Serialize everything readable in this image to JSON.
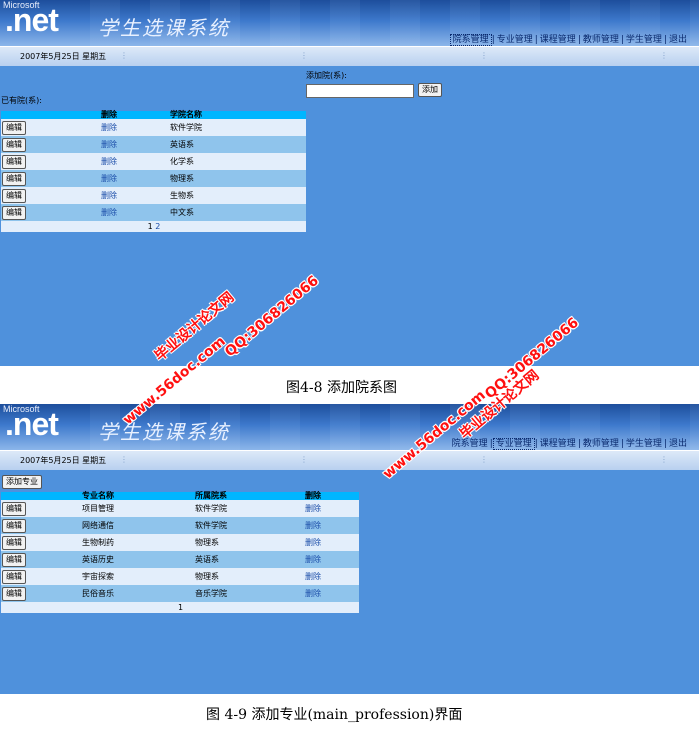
{
  "app": {
    "logo_top": "Microsoft",
    "logo": ".net",
    "title": "学生选课系统",
    "date": "2007年5月25日  星期五",
    "nav": [
      "院系管理",
      "专业管理",
      "课程管理",
      "教师管理",
      "学生管理",
      "退出"
    ]
  },
  "screen1": {
    "add_label": "添加院(系):",
    "add_input_value": "",
    "add_button": "添加",
    "list_label": "已有院(系):",
    "headers": [
      "",
      "删除",
      "学院名称"
    ],
    "rows": [
      {
        "edit": "编辑",
        "del": "删除",
        "name": "软件学院"
      },
      {
        "edit": "编辑",
        "del": "删除",
        "name": "英语系"
      },
      {
        "edit": "编辑",
        "del": "删除",
        "name": "化学系"
      },
      {
        "edit": "编辑",
        "del": "删除",
        "name": "物理系"
      },
      {
        "edit": "编辑",
        "del": "删除",
        "name": "生物系"
      },
      {
        "edit": "编辑",
        "del": "删除",
        "name": "中文系"
      }
    ],
    "pager": [
      "1",
      "2"
    ]
  },
  "caption1": "图4-8    添加院系图",
  "screen2": {
    "add_button": "添加专业",
    "headers": [
      "",
      "专业名称",
      "所属院系",
      "删除"
    ],
    "rows": [
      {
        "edit": "编辑",
        "name": "项目管理",
        "dept": "软件学院",
        "del": "删除"
      },
      {
        "edit": "编辑",
        "name": "网络通信",
        "dept": "软件学院",
        "del": "删除"
      },
      {
        "edit": "编辑",
        "name": "生物制药",
        "dept": "物理系",
        "del": "删除"
      },
      {
        "edit": "编辑",
        "name": "英语历史",
        "dept": "英语系",
        "del": "删除"
      },
      {
        "edit": "编辑",
        "name": "宇宙探索",
        "dept": "物理系",
        "del": "删除"
      },
      {
        "edit": "编辑",
        "name": "民俗音乐",
        "dept": "音乐学院",
        "del": "删除"
      }
    ],
    "pager": [
      "1"
    ]
  },
  "caption2": "图 4-9    添加专业(main_profession)界面",
  "watermarks": [
    "毕业设计论文网",
    "www.56doc.com",
    "QQ:306826066"
  ],
  "colors": {
    "accent": "#4f91dc",
    "header_row": "#00b6ff",
    "row_alt": "#8fc4ec",
    "row": "#e3eefb",
    "watermark": "#ff1010"
  }
}
